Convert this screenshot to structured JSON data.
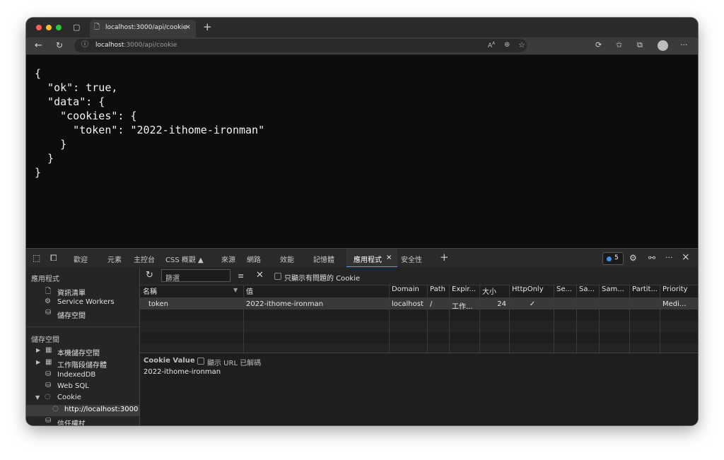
{
  "browser": {
    "tab_title": "localhost:3000/api/cookie",
    "tab_close": "×",
    "new_tab": "+",
    "url_host": "localhost",
    "url_path": ":3000/api/cookie"
  },
  "page": {
    "json_text": "{\n  \"ok\": true,\n  \"data\": {\n    \"cookies\": {\n      \"token\": \"2022-ithome-ironman\"\n    }\n  }\n}"
  },
  "devtools": {
    "tabs": [
      "歡迎",
      "元素",
      "主控台",
      "CSS 概觀 ▲",
      "來源",
      "網路",
      "效能",
      "記憶體",
      "應用程式",
      "安全性"
    ],
    "active_tab_close": "×",
    "add_tab": "+",
    "issues_count": "5",
    "more": "···",
    "close": "×",
    "sidebar": {
      "app_section": "應用程式",
      "app_items": [
        "資訊清單",
        "Service Workers",
        "儲存空間"
      ],
      "storage_section": "儲存空間",
      "storage_items": [
        "本機儲存空間",
        "工作階段儲存體",
        "IndexedDB",
        "Web SQL",
        "Cookie"
      ],
      "cookie_origin": "http://localhost:3000",
      "trust_tokens": "信任權杖"
    },
    "toolbar": {
      "filter_placeholder": "篩選",
      "only_issues_label": "只顯示有問題的 Cookie"
    },
    "table": {
      "headers": [
        "名稱",
        "值",
        "Domain",
        "Path",
        "Expir...",
        "大小",
        "HttpOnly",
        "Se...",
        "Sa...",
        "Sam...",
        "Partit...",
        "Priority"
      ],
      "row": [
        "token",
        "2022-ithome-ironman",
        "localhost",
        "/",
        "工作...",
        "24",
        "✓",
        "",
        "",
        "",
        "",
        "Medi..."
      ]
    },
    "value_pane": {
      "title": "Cookie Value",
      "decode_label": "顯示 URL 已解碼",
      "value": "2022-ithome-ironman"
    }
  },
  "colors": {
    "accent": "#4e9cff",
    "traffic_red": "#ff5f57",
    "traffic_yellow": "#febc2e",
    "traffic_green": "#28c840"
  }
}
